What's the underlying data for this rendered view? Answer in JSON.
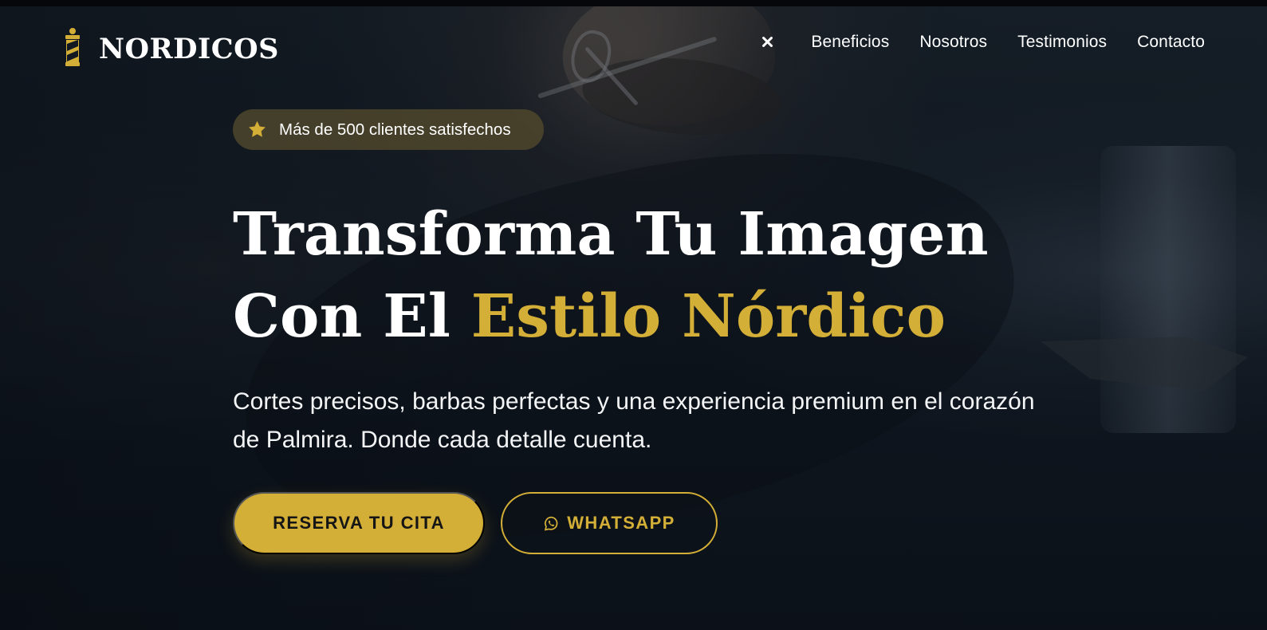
{
  "theme": {
    "accent": "#d4af37",
    "background": "#111821",
    "text": "#ffffff"
  },
  "brand": {
    "name": "NORDICOS",
    "icon": "barber-pole-icon"
  },
  "navigation": {
    "close_icon": "close-icon",
    "items": [
      {
        "label": "Beneficios"
      },
      {
        "label": "Nosotros"
      },
      {
        "label": "Testimonios"
      },
      {
        "label": "Contacto"
      }
    ]
  },
  "hero": {
    "badge": {
      "icon": "star-icon",
      "text": "Más de 500 clientes satisfechos"
    },
    "headline": {
      "line1": "Transforma Tu Imagen",
      "line2_prefix": "Con El ",
      "line2_accent": "Estilo Nórdico"
    },
    "subtitle": "Cortes precisos, barbas perfectas y una experiencia premium en el corazón de Palmira. Donde cada detalle cuenta.",
    "actions": {
      "primary": "RESERVA TU CITA",
      "secondary": "WHATSAPP",
      "secondary_icon": "whatsapp-icon"
    }
  }
}
